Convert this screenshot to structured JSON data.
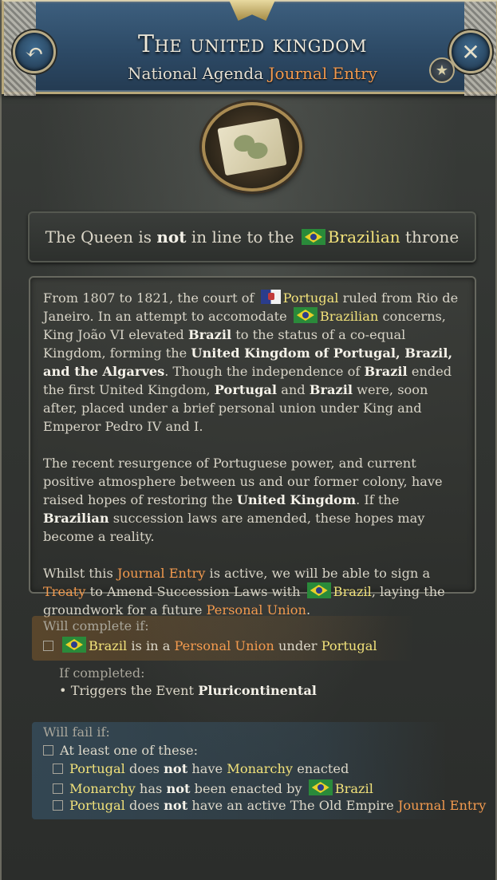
{
  "header": {
    "title": "The united kingdom",
    "subtitle_prefix": "National Agenda",
    "subtitle_highlight": "Journal Entry",
    "back_icon": "undo-arrow-icon",
    "close_icon": "close-x-icon",
    "star_icon": "star-icon"
  },
  "emblem": {
    "icon": "map-icon"
  },
  "status": {
    "part1": "The Queen is",
    "bold": "not",
    "part2": "in line to the",
    "country": "Brazilian",
    "part3": "throne"
  },
  "description": {
    "p1": [
      {
        "t": "From 1807 to 1821, the court of ",
        "s": ""
      },
      {
        "t": "",
        "s": "flag-pt"
      },
      {
        "t": "Portugal",
        "s": "yellow"
      },
      {
        "t": " ruled from Rio de Janeiro. In an attempt to accomodate ",
        "s": ""
      },
      {
        "t": "",
        "s": "flag-br"
      },
      {
        "t": "Brazilian",
        "s": "yellow"
      },
      {
        "t": " concerns, King João VI elevated ",
        "s": ""
      },
      {
        "t": "Brazil",
        "s": "white-b"
      },
      {
        "t": " to the status of a co-equal Kingdom, forming the ",
        "s": ""
      },
      {
        "t": "United Kingdom of Portugal, Brazil, and the Algarves",
        "s": "white-b"
      },
      {
        "t": ". Though the independence of ",
        "s": ""
      },
      {
        "t": "Brazil",
        "s": "white-b"
      },
      {
        "t": " ended the first United Kingdom, ",
        "s": ""
      },
      {
        "t": "Portugal",
        "s": "white-b"
      },
      {
        "t": " and ",
        "s": ""
      },
      {
        "t": "Brazil",
        "s": "white-b"
      },
      {
        "t": " were, soon after, placed under a brief personal union under King and Emperor Pedro IV and I.",
        "s": ""
      }
    ],
    "p2": [
      {
        "t": "The recent resurgence of Portuguese power, and current positive atmosphere between us and our former colony, have raised hopes of restoring the ",
        "s": ""
      },
      {
        "t": "United Kingdom",
        "s": "white-b"
      },
      {
        "t": ". If the ",
        "s": ""
      },
      {
        "t": "Brazilian",
        "s": "white-b"
      },
      {
        "t": " succession laws are amended, these hopes may become a reality.",
        "s": ""
      }
    ],
    "p3": [
      {
        "t": "Whilst this ",
        "s": ""
      },
      {
        "t": "Journal Entry",
        "s": "orange"
      },
      {
        "t": " is active, we will be able to sign a ",
        "s": ""
      },
      {
        "t": "Treaty",
        "s": "orange"
      },
      {
        "t": " to Amend Succession Laws with ",
        "s": ""
      },
      {
        "t": "",
        "s": "flag-br"
      },
      {
        "t": "Brazil",
        "s": "yellow"
      },
      {
        "t": ", laying the groundwork for a future ",
        "s": ""
      },
      {
        "t": "Personal Union",
        "s": "orange"
      },
      {
        "t": ".",
        "s": ""
      }
    ]
  },
  "complete": {
    "label": "Will complete if:",
    "condition": [
      {
        "t": "",
        "s": "flag-br"
      },
      {
        "t": "Brazil",
        "s": "yellow"
      },
      {
        "t": " is in a ",
        "s": ""
      },
      {
        "t": "Personal Union",
        "s": "orange"
      },
      {
        "t": " under ",
        "s": ""
      },
      {
        "t": "Portugal",
        "s": "yellow"
      }
    ],
    "if_completed_label": "If completed:",
    "effect_prefix": "• Triggers the Event",
    "effect_event": "Pluricontinental"
  },
  "fail": {
    "label": "Will fail if:",
    "group": "At least one of these:",
    "conditions": [
      [
        {
          "t": "Portugal",
          "s": "yellow"
        },
        {
          "t": " does ",
          "s": ""
        },
        {
          "t": "not",
          "s": "white-b"
        },
        {
          "t": " have ",
          "s": ""
        },
        {
          "t": "Monarchy",
          "s": "yellow"
        },
        {
          "t": " enacted",
          "s": ""
        }
      ],
      [
        {
          "t": "Monarchy",
          "s": "yellow"
        },
        {
          "t": " has ",
          "s": ""
        },
        {
          "t": "not",
          "s": "white-b"
        },
        {
          "t": " been enacted by ",
          "s": ""
        },
        {
          "t": "",
          "s": "flag-br"
        },
        {
          "t": "Brazil",
          "s": "yellow"
        }
      ],
      [
        {
          "t": "Portugal",
          "s": "yellow"
        },
        {
          "t": " does ",
          "s": ""
        },
        {
          "t": "not",
          "s": "white-b"
        },
        {
          "t": " have an active The Old Empire ",
          "s": ""
        },
        {
          "t": "Journal Entry",
          "s": "orange"
        }
      ]
    ]
  },
  "colors": {
    "header_blue": "#2d4a66",
    "highlight_yellow": "#f2e27a",
    "highlight_orange": "#f39a4e",
    "complete_tint": "#aa6e28",
    "fail_tint": "#3c6482"
  }
}
